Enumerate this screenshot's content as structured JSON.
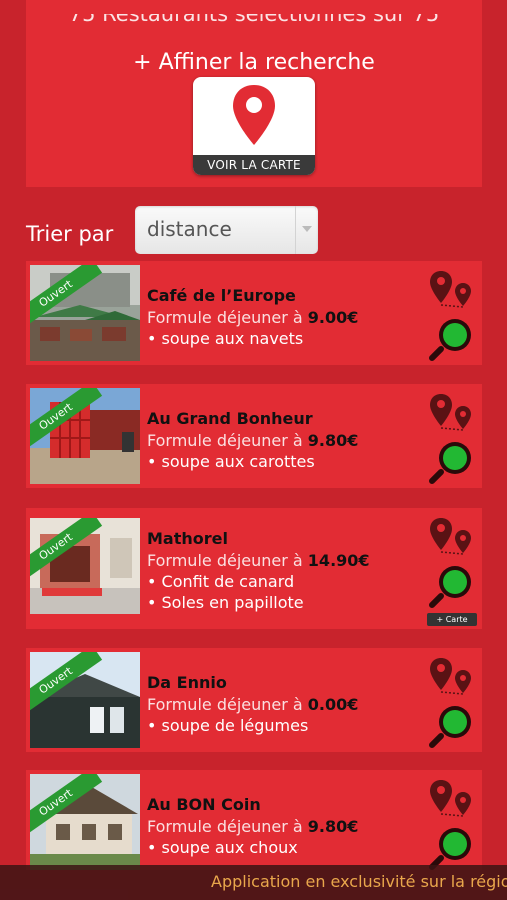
{
  "header": {
    "count_text": "75 Restaurants sélectionnés sur 75",
    "refine_label": "+ Affiner la recherche",
    "map_button_label": "VOIR LA CARTE",
    "map_icon": "map-pin-icon"
  },
  "sort": {
    "label": "Trier par",
    "selected": "distance"
  },
  "restaurants": [
    {
      "status": "Ouvert",
      "name": "Café de l’Europe",
      "formule_label": "Formule déjeuner à",
      "price": "9.00€",
      "dishes": [
        "• soupe aux navets"
      ]
    },
    {
      "status": "Ouvert",
      "name": "Au Grand Bonheur",
      "formule_label": "Formule déjeuner à",
      "price": "9.80€",
      "dishes": [
        "• soupe aux carottes"
      ]
    },
    {
      "status": "Ouvert",
      "name": "Mathorel",
      "formule_label": "Formule déjeuner à",
      "price": "14.90€",
      "dishes": [
        "• Confit de canard",
        "• Soles en papillote"
      ],
      "more_label": "+ Carte"
    },
    {
      "status": "Ouvert",
      "name": "Da Ennio",
      "formule_label": "Formule déjeuner à",
      "price": "0.00€",
      "dishes": [
        "• soupe de légumes"
      ]
    },
    {
      "status": "Ouvert",
      "name": "Au BON Coin",
      "formule_label": "Formule déjeuner à",
      "price": "9.80€",
      "dishes": [
        "• soupe aux choux"
      ]
    }
  ],
  "footer": {
    "text": "Application en exclusivité sur la régio"
  },
  "colors": {
    "background": "#c8232c",
    "card": "#e22c34",
    "ribbon": "#2a9a32",
    "footer_text": "#e9a74c"
  }
}
